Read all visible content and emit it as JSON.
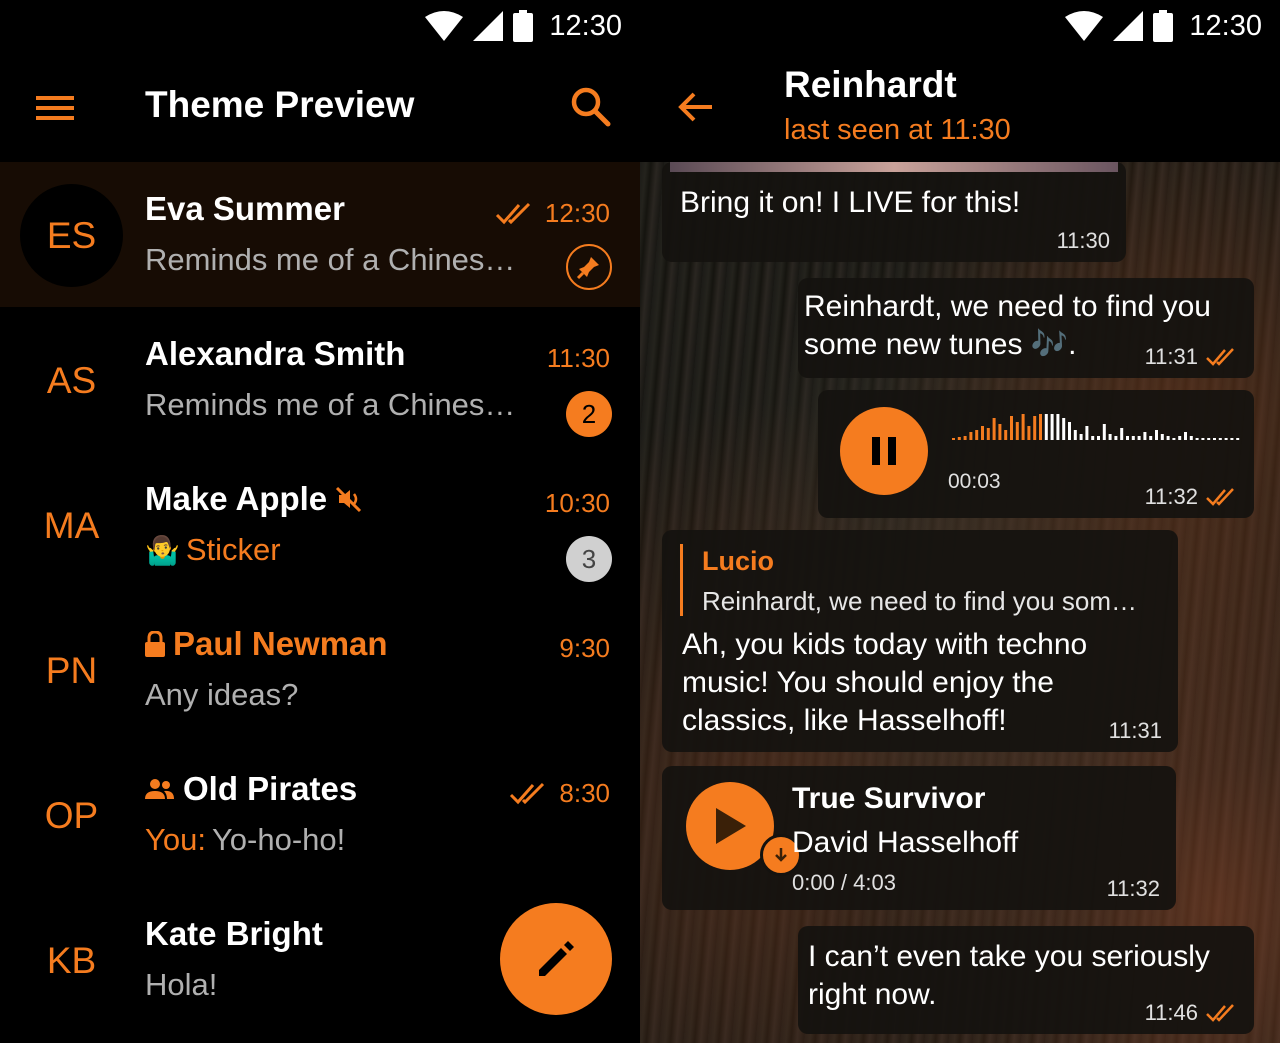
{
  "status_bar": {
    "time": "12:30"
  },
  "left": {
    "title": "Theme Preview",
    "chats": [
      {
        "initials": "ES",
        "name": "Eva Summer",
        "time": "12:30",
        "preview": "Reminds me of a Chines…",
        "read": true,
        "pinned": true,
        "selected": true
      },
      {
        "initials": "AS",
        "name": "Alexandra Smith",
        "time": "11:30",
        "preview": "Reminds me of a Chines…",
        "unread": "2"
      },
      {
        "initials": "MA",
        "name": "Make Apple",
        "time": "10:30",
        "preview": "Sticker",
        "preview_emoji": "🤷‍♂️",
        "muted": true,
        "unread": "3"
      },
      {
        "initials": "PN",
        "name": "Paul Newman",
        "time": "9:30",
        "preview": "Any ideas?",
        "secret": true
      },
      {
        "initials": "OP",
        "name": "Old Pirates",
        "time": "8:30",
        "preview_sender": "You:",
        "preview": "Yo-ho-ho!",
        "group": true,
        "read": true
      },
      {
        "initials": "KB",
        "name": "Kate Bright",
        "time": "",
        "preview": "Hola!"
      }
    ]
  },
  "right": {
    "peer_name": "Reinhardt",
    "peer_status": "last seen at 11:30",
    "messages": [
      {
        "text": "Bring it on! I LIVE for this!",
        "time": "11:30"
      },
      {
        "text": "Reinhardt, we need to find you some new tunes 🎶.",
        "time": "11:31"
      },
      {
        "voice_duration": "00:03",
        "time": "11:32"
      },
      {
        "reply_name": "Lucio",
        "reply_text": "Reinhardt, we need to find you som…",
        "text": "Ah, you kids today with techno music! You should enjoy the classics, like Hasselhoff!",
        "time": "11:31"
      },
      {
        "music_title": "True Survivor",
        "music_artist": "David Hasselhoff",
        "music_progress": "0:00 / 4:03",
        "time": "11:32"
      },
      {
        "text": "I can’t even take you seriously right now.",
        "time": "11:46"
      }
    ]
  },
  "colors": {
    "accent": "#f57c1f",
    "background": "#000000",
    "bubble": "#14120f"
  },
  "icons": [
    "menu-icon",
    "search-icon",
    "double-check-icon",
    "pin-icon",
    "mute-icon",
    "lock-icon",
    "group-icon",
    "pencil-icon",
    "back-arrow-icon",
    "pause-icon",
    "play-icon",
    "download-icon",
    "wifi-icon",
    "signal-icon",
    "battery-icon"
  ]
}
